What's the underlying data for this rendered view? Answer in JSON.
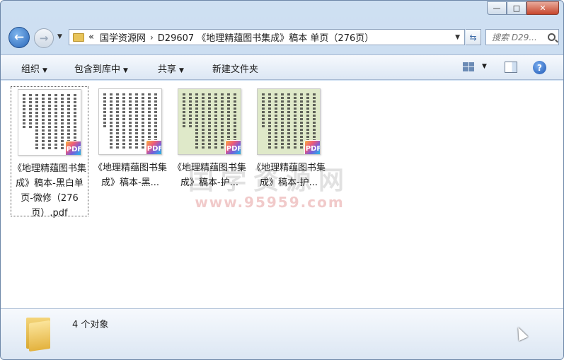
{
  "window": {
    "minimize": "—",
    "maximize": "□",
    "close": "✕"
  },
  "nav": {
    "back": "←",
    "forward": "→",
    "breadcrumb_prefix": "«",
    "crumbs": [
      "国学资源网",
      "D29607 《地理精蕴图书集成》稿本 单页（276页）"
    ],
    "separator": "›",
    "search_placeholder": "搜索 D29..."
  },
  "toolbar": {
    "organize": "组织",
    "include_library": "包含到库中",
    "share": "共享",
    "new_folder": "新建文件夹",
    "help": "?"
  },
  "watermark": {
    "main": "国学资源网",
    "url": "www.95959.com"
  },
  "files": [
    {
      "name": "《地理精蕴图书集成》稿本-黑白单页-微修（276页）.pdf",
      "badge": "PDF",
      "selected": true
    },
    {
      "name": "《地理精蕴图书集成》稿本-黑...",
      "badge": "PDF",
      "selected": false
    },
    {
      "name": "《地理精蕴图书集成》稿本-护...",
      "badge": "PDF",
      "selected": false
    },
    {
      "name": "《地理精蕴图书集成》稿本-护...",
      "badge": "PDF",
      "selected": false
    }
  ],
  "status": {
    "count": "4 个对象"
  }
}
